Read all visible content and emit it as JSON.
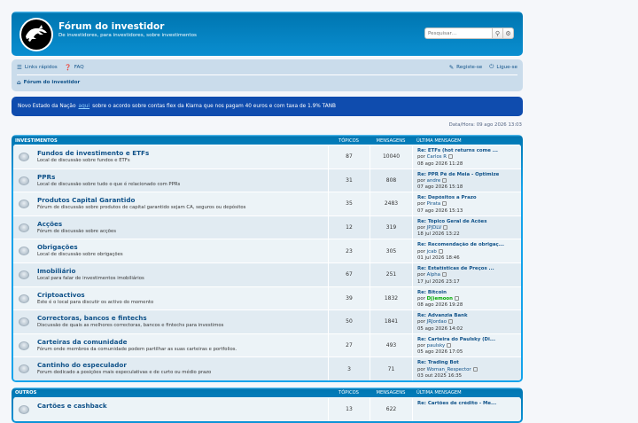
{
  "header": {
    "title": "Fórum do investidor",
    "description": "De investidores, para investidores, sobre investimentos",
    "search_placeholder": "Pesquisar…"
  },
  "nav": {
    "quick_links": "Links rápidos",
    "faq": "FAQ",
    "register": "Registe-se",
    "login": "Ligue-se",
    "home": "Fórum do investidor"
  },
  "announcement": {
    "before": "Novo Estado da Nação",
    "link": "aqui",
    "after": "sobre o acordo sobre contas flex da Klarna que nos pagam 40 euros e com taxa de 1.9% TANB"
  },
  "datetime": "Data/Hora: 09 ago 2026 13:03",
  "columns": {
    "topics": "TÓPICOS",
    "posts": "MENSAGENS",
    "last_post": "ÚLTIMA MENSAGEM"
  },
  "sections": [
    {
      "title": "INVESTIMENTOS",
      "forums": [
        {
          "name": "Fundos de investimento e ETFs",
          "desc": "Local de discussão sobre fundos e ETFs",
          "topics": "87",
          "posts": "10040",
          "last_title": "Re: ETFs (hot returns come ...",
          "last_user": "Carlos R",
          "last_date": "08 ago 2026 11:28"
        },
        {
          "name": "PPRs",
          "desc": "Local de discussão sobre tudo o que é relacionado com PPRs",
          "topics": "31",
          "posts": "808",
          "last_title": "Re: PPR Pé de Meia - Optimize",
          "last_user": "andre",
          "last_date": "07 ago 2026 15:18"
        },
        {
          "name": "Produtos Capital Garantido",
          "desc": "Fórum de discussão sobre produtos de capital garantido sejam CA, seguros ou depósitos",
          "topics": "35",
          "posts": "2483",
          "last_title": "Re: Depósitos a Prazo",
          "last_user": "Pirata",
          "last_date": "07 ago 2026 15:13"
        },
        {
          "name": "Acções",
          "desc": "Fórum de discussão sobre acções",
          "topics": "12",
          "posts": "319",
          "last_title": "Re: Tópico Geral de Acões",
          "last_user": "JPJDLV",
          "last_date": "18 jul 2026 13:22"
        },
        {
          "name": "Obrigações",
          "desc": "Local de discussão sobre obrigações",
          "topics": "23",
          "posts": "305",
          "last_title": "Re: Recomendação de obrigaç...",
          "last_user": "jcab",
          "last_date": "01 jul 2026 18:46"
        },
        {
          "name": "Imobiliário",
          "desc": "Local para falar de investimentos imobiliários",
          "topics": "67",
          "posts": "251",
          "last_title": "Re: Estatísticas de Preços ...",
          "last_user": "Alpha",
          "last_date": "17 jul 2026 23:17"
        },
        {
          "name": "Criptoactivos",
          "desc": "Este é o local para discutir os activo do momento",
          "topics": "39",
          "posts": "1832",
          "last_title": "Re: Bitcoin",
          "last_user": "Dj)emoon",
          "last_user_green": true,
          "last_date": "08 ago 2026 19:28"
        },
        {
          "name": "Correctoras, bancos e fintechs",
          "desc": "Discussão de quais as melhores correctoras, bancos e fintechs para investimos",
          "topics": "50",
          "posts": "1841",
          "last_title": "Re: Advanzia Bank",
          "last_user": "JRJordao",
          "last_date": "05 ago 2026 14:02"
        },
        {
          "name": "Carteiras da comunidade",
          "desc": "Fórum onde membros da comunidade podem partilhar as suas carteiras e portfolios.",
          "topics": "27",
          "posts": "493",
          "last_title": "Re: Carteira do Paulsky (Di...",
          "last_user": "paulsky",
          "last_date": "05 ago 2026 17:05"
        },
        {
          "name": "Cantinho do especulador",
          "desc": "Forum dedicado a posições mais especulativas e de curto ou médio prazo",
          "topics": "3",
          "posts": "71",
          "last_title": "Re: Trading Bot",
          "last_user": "Woman_Respector",
          "last_date": "03 out 2025 16:35"
        }
      ]
    },
    {
      "title": "OUTROS",
      "forums": [
        {
          "name": "Cartões e cashback",
          "desc": "",
          "topics": "13",
          "posts": "622",
          "last_title": "Re: Cartões de crédito - Me...",
          "last_user": "",
          "last_date": ""
        }
      ]
    }
  ],
  "by_label": "por"
}
